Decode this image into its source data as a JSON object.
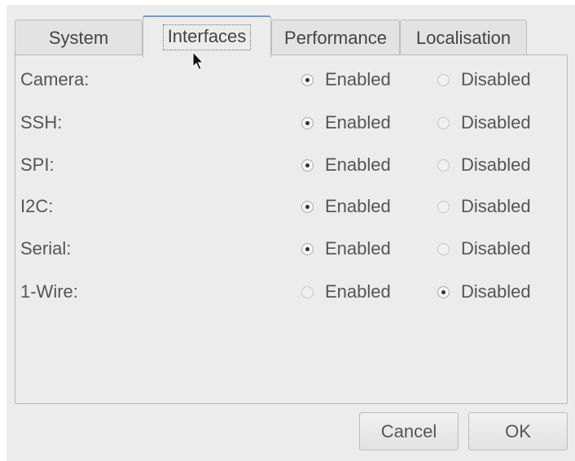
{
  "tabs": [
    {
      "label": "System"
    },
    {
      "label": "Interfaces",
      "active": true
    },
    {
      "label": "Performance"
    },
    {
      "label": "Localisation"
    }
  ],
  "interfaces": [
    {
      "label": "Camera:",
      "enabled_label": "Enabled",
      "disabled_label": "Disabled",
      "selected": "enabled"
    },
    {
      "label": "SSH:",
      "enabled_label": "Enabled",
      "disabled_label": "Disabled",
      "selected": "enabled"
    },
    {
      "label": "SPI:",
      "enabled_label": "Enabled",
      "disabled_label": "Disabled",
      "selected": "enabled"
    },
    {
      "label": "I2C:",
      "enabled_label": "Enabled",
      "disabled_label": "Disabled",
      "selected": "enabled"
    },
    {
      "label": "Serial:",
      "enabled_label": "Enabled",
      "disabled_label": "Disabled",
      "selected": "enabled"
    },
    {
      "label": "1-Wire:",
      "enabled_label": "Enabled",
      "disabled_label": "Disabled",
      "selected": "disabled"
    }
  ],
  "buttons": {
    "cancel": "Cancel",
    "ok": "OK"
  },
  "colors": {
    "active_tab_accent": "#6f9bd1",
    "window_background": "#ececec"
  },
  "icons": {
    "cursor": "mouse-pointer-icon"
  }
}
